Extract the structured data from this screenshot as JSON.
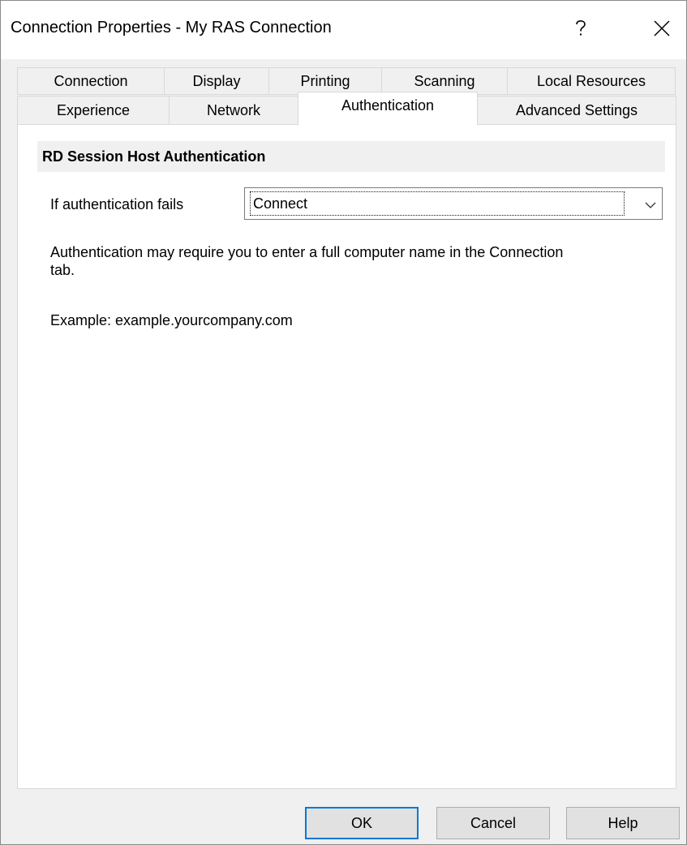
{
  "window": {
    "title": "Connection Properties - My RAS Connection",
    "help_icon": "question-mark-icon",
    "close_icon": "close-icon"
  },
  "tabs": {
    "row_top": [
      {
        "label": "Connection"
      },
      {
        "label": "Display"
      },
      {
        "label": "Printing"
      },
      {
        "label": "Scanning"
      },
      {
        "label": "Local Resources"
      }
    ],
    "row_bottom": [
      {
        "label": "Experience"
      },
      {
        "label": "Network"
      },
      {
        "label": "Authentication",
        "active": true
      },
      {
        "label": "Advanced Settings"
      }
    ]
  },
  "panel": {
    "section_title": "RD Session Host Authentication",
    "field_label": "If authentication fails",
    "dropdown_value": "Connect",
    "description": "Authentication may require you to enter a full computer name in the Connection tab.",
    "example": "Example: example.yourcompany.com"
  },
  "buttons": {
    "ok": "OK",
    "cancel": "Cancel",
    "help": "Help"
  },
  "colors": {
    "accent": "#0078d7",
    "window_bg": "#f0f0f0",
    "panel_bg": "#ffffff"
  }
}
